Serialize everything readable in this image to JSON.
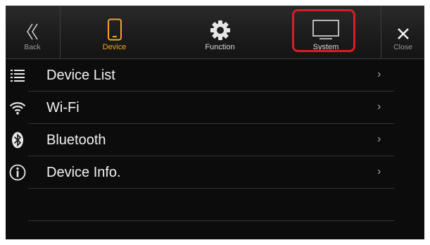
{
  "header": {
    "tabs": [
      {
        "id": "back",
        "label": "Back",
        "icon": "double-chevron-left-icon"
      },
      {
        "id": "device",
        "label": "Device",
        "icon": "phone-icon",
        "active_color": "#f0a81e"
      },
      {
        "id": "function",
        "label": "Function",
        "icon": "gear-icon"
      },
      {
        "id": "system",
        "label": "System",
        "icon": "monitor-icon"
      },
      {
        "id": "close",
        "label": "Close",
        "icon": "close-icon"
      }
    ],
    "highlight_color": "#d81e26"
  },
  "list": {
    "items": [
      {
        "label": "Device List",
        "icon": "list-icon"
      },
      {
        "label": "Wi-Fi",
        "icon": "wifi-icon"
      },
      {
        "label": "Bluetooth",
        "icon": "bluetooth-icon"
      },
      {
        "label": "Device Info.",
        "icon": "info-icon"
      }
    ],
    "chevron": "›"
  }
}
